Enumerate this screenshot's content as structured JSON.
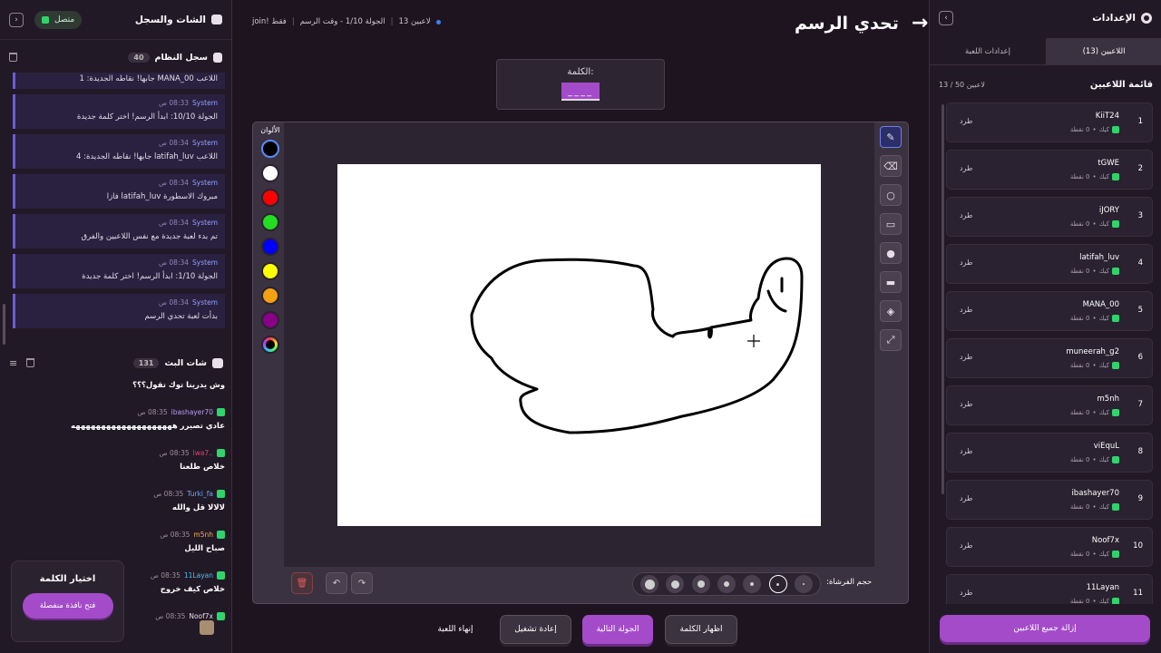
{
  "left": {
    "title": "الشات والسجل",
    "status": "متصل",
    "syslog": {
      "title": "سجل النظام",
      "count": "40",
      "entries": [
        {
          "time": "",
          "who": "",
          "msg": "اللاعب MANA_00 جابها! نقاطه الجديدة: 1"
        },
        {
          "time": "08:33 ص",
          "who": "System",
          "msg": "الجولة 10/10: ابدأ الرسم! اختر كلمة جديدة"
        },
        {
          "time": "08:34 ص",
          "who": "System",
          "msg": "اللاعب latifah_luv جابها! نقاطه الجديدة: 4"
        },
        {
          "time": "08:34 ص",
          "who": "System",
          "msg": "مبروك الاسطورة latifah_luv فازا"
        },
        {
          "time": "08:34 ص",
          "who": "System",
          "msg": "تم بدء لعبة جديدة مع نفس اللاعبين والفرق"
        },
        {
          "time": "08:34 ص",
          "who": "System",
          "msg": "الجولة 1/10: ابدأ الرسم! اختر كلمة جديدة"
        },
        {
          "time": "08:34 ص",
          "who": "System",
          "msg": "بدأت لعبة تحدي الرسم"
        }
      ]
    },
    "chat": {
      "title": "شات البث",
      "count": "131",
      "messages": [
        {
          "user": "",
          "time": "",
          "color": "#fff",
          "msg": "وش يدرينا توك تقول؟؟؟"
        },
        {
          "user": "ibashayer70",
          "time": "08:35 ص",
          "color": "#b59cf0",
          "msg": "عادي تصيرر ههههههههههههههههههههه"
        },
        {
          "user": "..lwa7",
          "time": "08:35 ص",
          "color": "#e0406a",
          "msg": "خلاص طلعنا"
        },
        {
          "user": "Turki_fa",
          "time": "08:35 ص",
          "color": "#6aa8ff",
          "msg": "لالالا قل والله"
        },
        {
          "user": "m5nh",
          "time": "08:35 ص",
          "color": "#f0b050",
          "msg": "صباح الليل"
        },
        {
          "user": "11Layan",
          "time": "08:35 ص",
          "color": "#4fc0f0",
          "msg": "خلاص كيف خروج"
        },
        {
          "user": "Noof7x",
          "time": "08:35 ص",
          "color": "#e8e0ea",
          "msg": ""
        }
      ]
    },
    "pick": {
      "title": "اختيار الكلمة",
      "button": "فتح نافذة منفصلة"
    }
  },
  "center": {
    "status": {
      "join": "join! فقط",
      "round": "الجولة 1/10 - وقت الرسم",
      "players": "13 لاعبين"
    },
    "title": "تحدي الرسم",
    "word_label": "الكلمة:",
    "word_blank": "____",
    "palette_label": "الألوان",
    "colors": [
      "#000000",
      "#ffffff",
      "#ff0000",
      "#22dd22",
      "#0000ff",
      "#ffff00",
      "#f5a010",
      "#880088"
    ],
    "brush_label": "حجم الفرشاة:",
    "actions": {
      "end": "إنهاء اللعبة",
      "restart": "إعادة تشغيل",
      "next": "الجولة التالية",
      "reveal": "اظهار الكلمة"
    }
  },
  "right": {
    "title": "الإعدادات",
    "tabs": {
      "players": "اللاعبين (13)",
      "settings": "إعدادات اللعبة"
    },
    "list_title": "قائمة اللاعبين",
    "list_count": "13 / 50 لاعبين",
    "kick": "طرد",
    "team": "كيك",
    "points": "0 نقطة",
    "players": [
      {
        "num": "1",
        "name": "KiiT24"
      },
      {
        "num": "2",
        "name": "tGWE"
      },
      {
        "num": "3",
        "name": "iJORY"
      },
      {
        "num": "4",
        "name": "latifah_luv"
      },
      {
        "num": "5",
        "name": "MANA_00"
      },
      {
        "num": "6",
        "name": "muneerah_g2"
      },
      {
        "num": "7",
        "name": "m5nh"
      },
      {
        "num": "8",
        "name": "viEquL"
      },
      {
        "num": "9",
        "name": "ibashayer70"
      },
      {
        "num": "10",
        "name": "Noof7x"
      },
      {
        "num": "11",
        "name": "11Layan"
      }
    ],
    "remove_all": "إزالة جميع اللاعبين"
  }
}
